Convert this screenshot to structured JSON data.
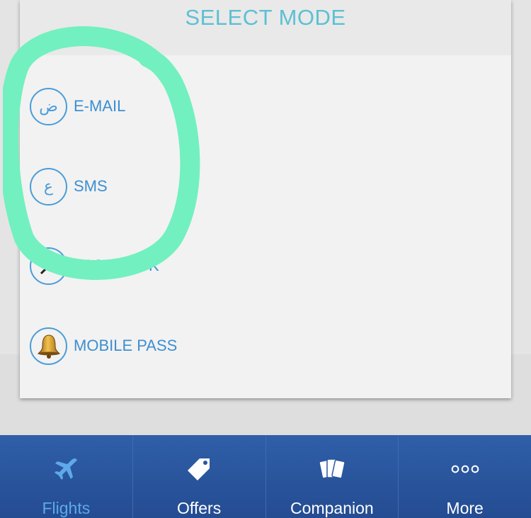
{
  "modal": {
    "title": "SELECT MODE",
    "options": [
      {
        "label": "E-MAIL",
        "glyph": "ض",
        "icon": "arabic-letter-icon"
      },
      {
        "label": "SMS",
        "glyph": "ع",
        "icon": "arabic-letter-icon"
      },
      {
        "label": "PASSBOOK",
        "glyph": "",
        "icon": "passbook-icon"
      },
      {
        "label": "MOBILE PASS",
        "glyph": "",
        "icon": "bell-icon"
      }
    ]
  },
  "tabbar": {
    "tabs": [
      {
        "label": "Flights",
        "icon": "airplane-icon",
        "active": true
      },
      {
        "label": "Offers",
        "icon": "tag-icon",
        "active": false
      },
      {
        "label": "Companion",
        "icon": "cards-icon",
        "active": false
      },
      {
        "label": "More",
        "icon": "more-dots-icon",
        "active": false
      }
    ]
  },
  "colors": {
    "title": "#5cc0d3",
    "option_text": "#3d8fd0",
    "highlight": "#72f0c0",
    "tabbar": "#2a56a0",
    "tab_active": "#5fa9e8"
  }
}
